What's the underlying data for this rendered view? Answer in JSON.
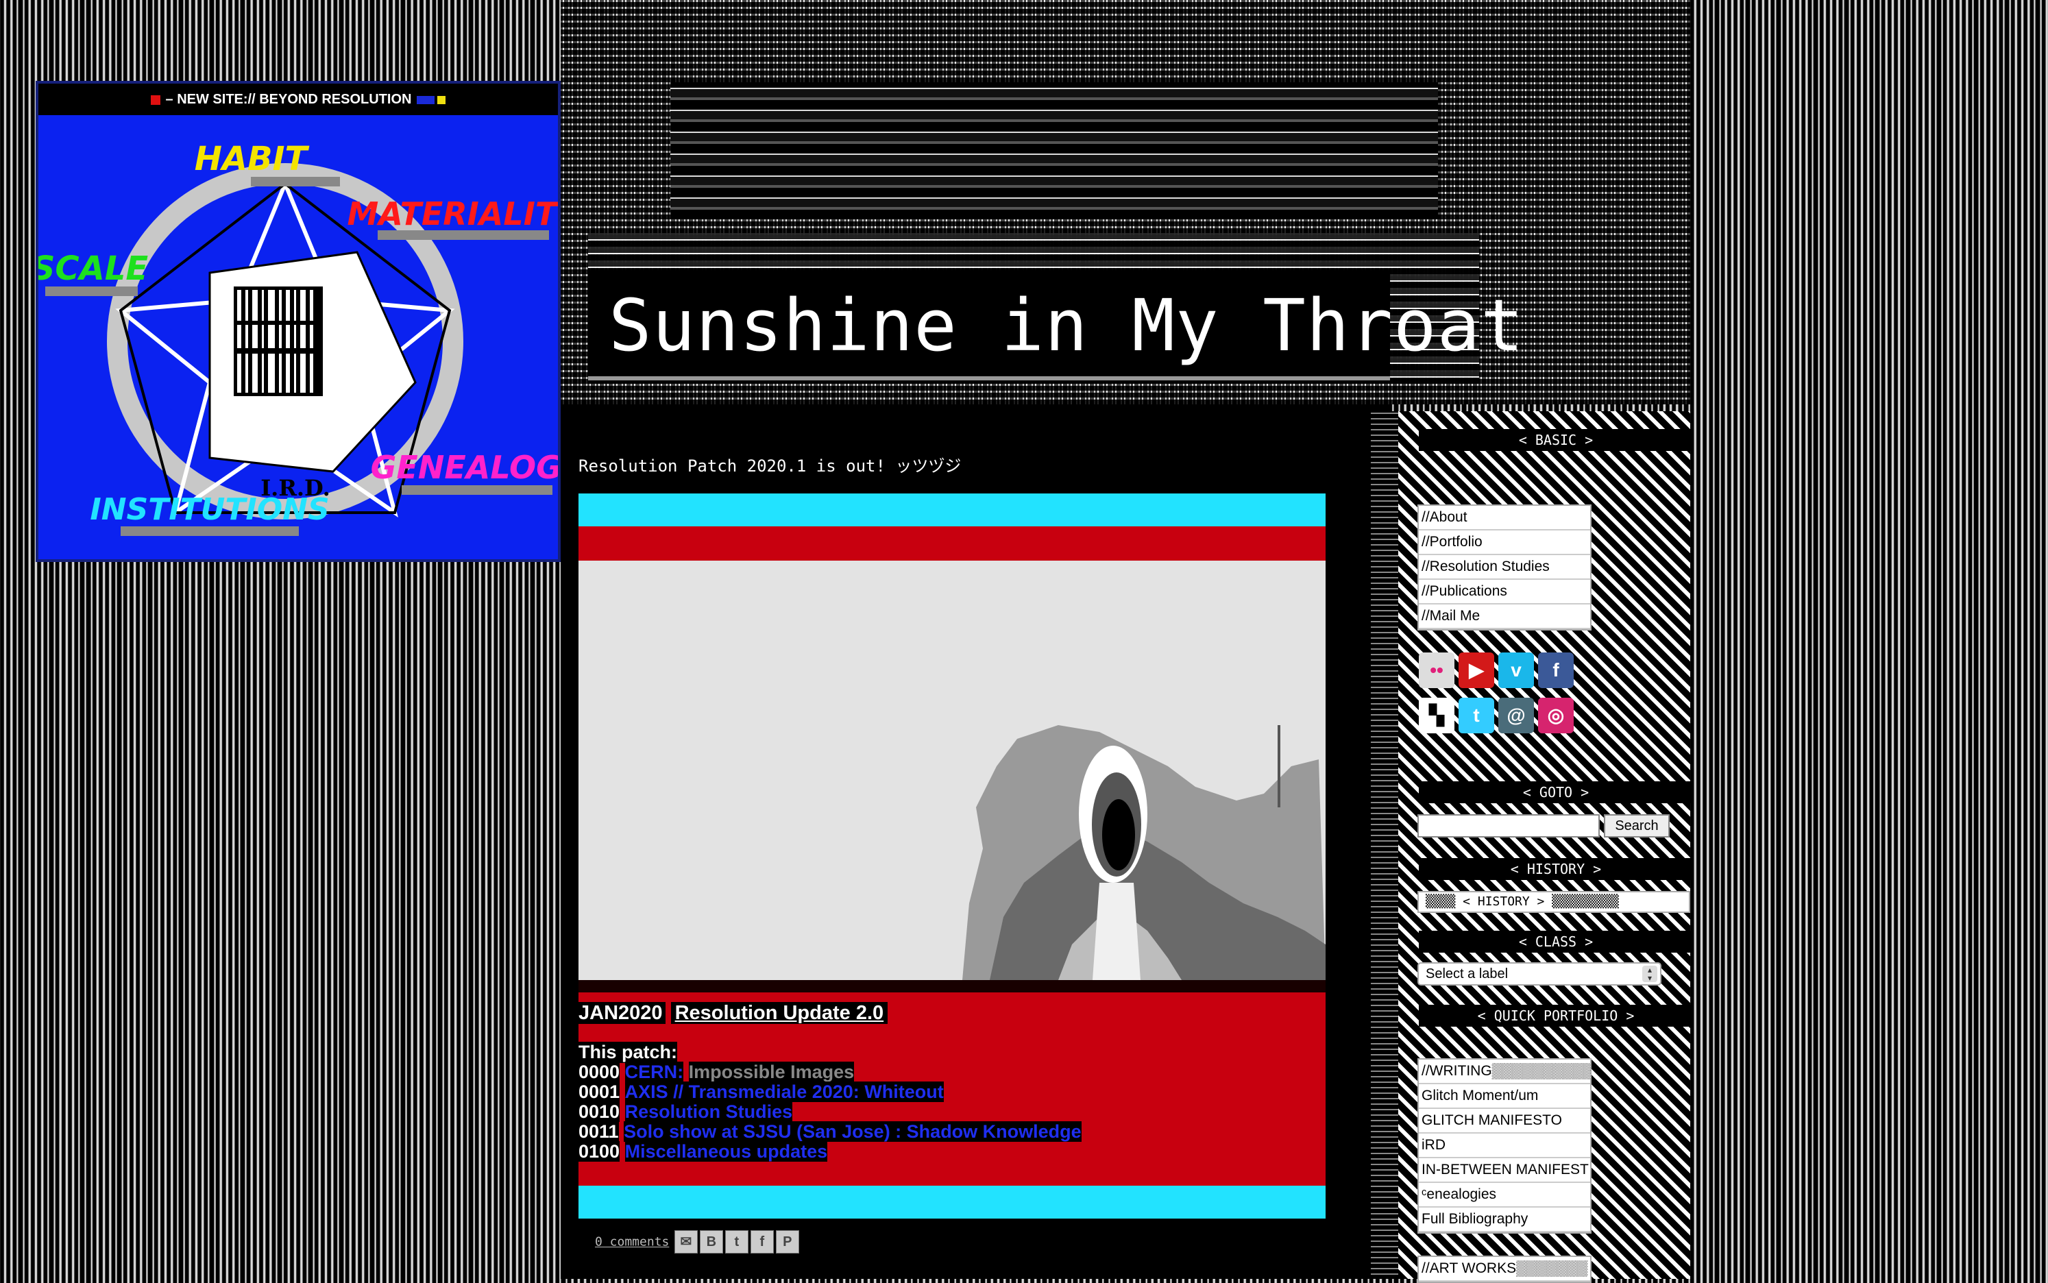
{
  "badge": {
    "banner": "– NEW SITE:// BEYOND RESOLUTION",
    "words": {
      "habit": "HABIT",
      "materiality": "MATERIALITY",
      "scale": "SCALE",
      "genealogy": "GENEALOGY",
      "institutions": "INSTITUTIONS",
      "ird": "I.R.D."
    }
  },
  "header": {
    "title": "Sunshine in My Throat"
  },
  "post": {
    "announcement": "Resolution Patch 2020.1 is out! ッツヅジ",
    "date": "JAN2020",
    "title": "Resolution Update 2.0",
    "patch_heading": "This patch:",
    "patch_items": [
      {
        "num": "0000",
        "link": "CERN:",
        "rest": "Impossible Images"
      },
      {
        "num": "0001",
        "link": "AXIS // Transmediale 2020: Whiteout",
        "rest": ""
      },
      {
        "num": "0010",
        "link": "Resolution Studies",
        "rest": ""
      },
      {
        "num": "0011",
        "link": "Solo show at SJSU (San Jose) : Shadow Knowledge",
        "rest": ""
      },
      {
        "num": "0100",
        "link": "Miscellaneous updates",
        "rest": ""
      }
    ],
    "comments": "0 comments",
    "share_icons": [
      "email-icon",
      "blogger-icon",
      "twitter-icon",
      "facebook-icon",
      "pinterest-icon"
    ]
  },
  "sidebar": {
    "basic_heading": "< BASIC >",
    "basic_links": [
      "//About",
      "//Portfolio",
      "//Resolution Studies",
      "//Publications",
      "//Mail Me"
    ],
    "social_icons": [
      "flickr-icon",
      "youtube-icon",
      "vimeo-icon",
      "facebook-icon",
      "delicious-icon",
      "twitter-icon",
      "email-icon",
      "instagram-icon"
    ],
    "goto_heading": "< GOTO >",
    "search_button": "Search",
    "history_heading": "< HISTORY >",
    "history_value": "▒▒▒▒ < HISTORY > ▒▒▒▒▒▒▒▒▒",
    "class_heading": "< CLASS >",
    "class_select": "Select a label",
    "portfolio_heading": "< QUICK PORTFOLIO >",
    "portfolio_links": [
      "//WRITING▒▒▒▒▒▒▒▒▒▒",
      "Glitch Moment/um",
      "GLITCH MANIFESTO",
      "iRD",
      "IN-BETWEEN MANIFEST",
      "ᶜenealogies",
      "Full Bibliography"
    ],
    "artworks_link": "//ART WORKS▒▒▒▒▒▒▒"
  },
  "colors": {
    "badge_blue": "#0b22f0",
    "post_red": "#c8000f",
    "post_cyan": "#22e3ff",
    "link_blue": "#1f2ef0"
  }
}
